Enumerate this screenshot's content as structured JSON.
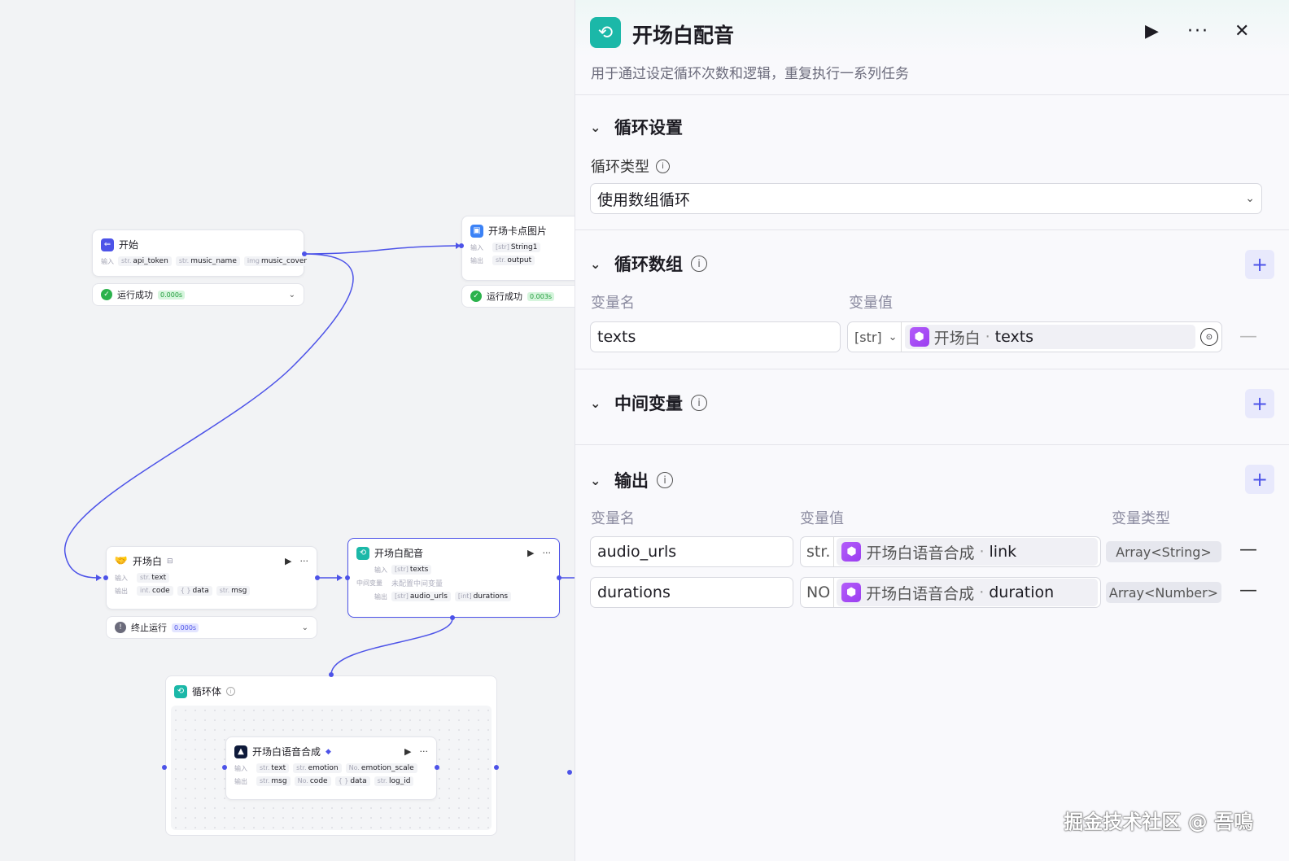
{
  "canvas": {
    "start_node": {
      "title": "开始",
      "in_label": "输入",
      "inputs": [
        {
          "t": "str.",
          "n": "api_token"
        },
        {
          "t": "str.",
          "n": "music_name"
        },
        {
          "t": "img",
          "n": "music_cover"
        }
      ],
      "status": "运行成功",
      "time": "0.000s"
    },
    "card_node": {
      "title": "开场卡点图片",
      "in_label": "输入",
      "out_label": "输出",
      "input": {
        "t": "[str]",
        "n": "String1"
      },
      "output": {
        "t": "str.",
        "n": "output"
      },
      "status": "运行成功",
      "time": "0.003s"
    },
    "opening_node": {
      "title": "开场白",
      "in_label": "输入",
      "out_label": "输出",
      "input": {
        "t": "str.",
        "n": "text"
      },
      "outputs": [
        {
          "t": "int.",
          "n": "code"
        },
        {
          "t": "{ }",
          "n": "data"
        },
        {
          "t": "str.",
          "n": "msg"
        }
      ],
      "status": "终止运行",
      "time": "0.000s"
    },
    "loop_node": {
      "title": "开场白配音",
      "in_label": "输入",
      "mid_label": "中间变量",
      "out_label": "输出",
      "input": {
        "t": "[str]",
        "n": "texts"
      },
      "mid_value": "未配置中间变量",
      "outputs": [
        {
          "t": "[str]",
          "n": "audio_urls"
        },
        {
          "t": "[int]",
          "n": "durations"
        }
      ]
    },
    "loop_body": {
      "title": "循环体"
    },
    "tts_node": {
      "title": "开场白语音合成",
      "in_label": "输入",
      "out_label": "输出",
      "inputs": [
        {
          "t": "str.",
          "n": "text"
        },
        {
          "t": "str.",
          "n": "emotion"
        },
        {
          "t": "No.",
          "n": "emotion_scale"
        }
      ],
      "outputs": [
        {
          "t": "str.",
          "n": "msg"
        },
        {
          "t": "No.",
          "n": "code"
        },
        {
          "t": "{ }",
          "n": "data"
        },
        {
          "t": "str.",
          "n": "log_id"
        }
      ]
    }
  },
  "panel": {
    "title": "开场白配音",
    "description": "用于通过设定循环次数和逻辑，重复执行一系列任务",
    "loop_settings": {
      "title": "循环设置",
      "type_label": "循环类型",
      "type_value": "使用数组循环"
    },
    "loop_array": {
      "title": "循环数组",
      "col_name": "变量名",
      "col_value": "变量值",
      "row": {
        "name": "texts",
        "type": "[str]",
        "source_node": "开场白",
        "source_var": "texts"
      }
    },
    "intermediate": {
      "title": "中间变量"
    },
    "output": {
      "title": "输出",
      "col_name": "变量名",
      "col_value": "变量值",
      "col_type": "变量类型",
      "rows": [
        {
          "name": "audio_urls",
          "type_short": "str.",
          "source_node": "开场白语音合成",
          "source_var": "link",
          "var_type": "Array<String>"
        },
        {
          "name": "durations",
          "type_short": "NO",
          "source_node": "开场白语音合成",
          "source_var": "duration",
          "var_type": "Array<Number>"
        }
      ]
    }
  },
  "watermark": "掘金技术社区 @ 吾鳴",
  "colors": {
    "accent": "#4d53e8",
    "loop_teal": "#1bb8a8",
    "success": "#2bb24c",
    "var_purple": "#a24cf4"
  }
}
